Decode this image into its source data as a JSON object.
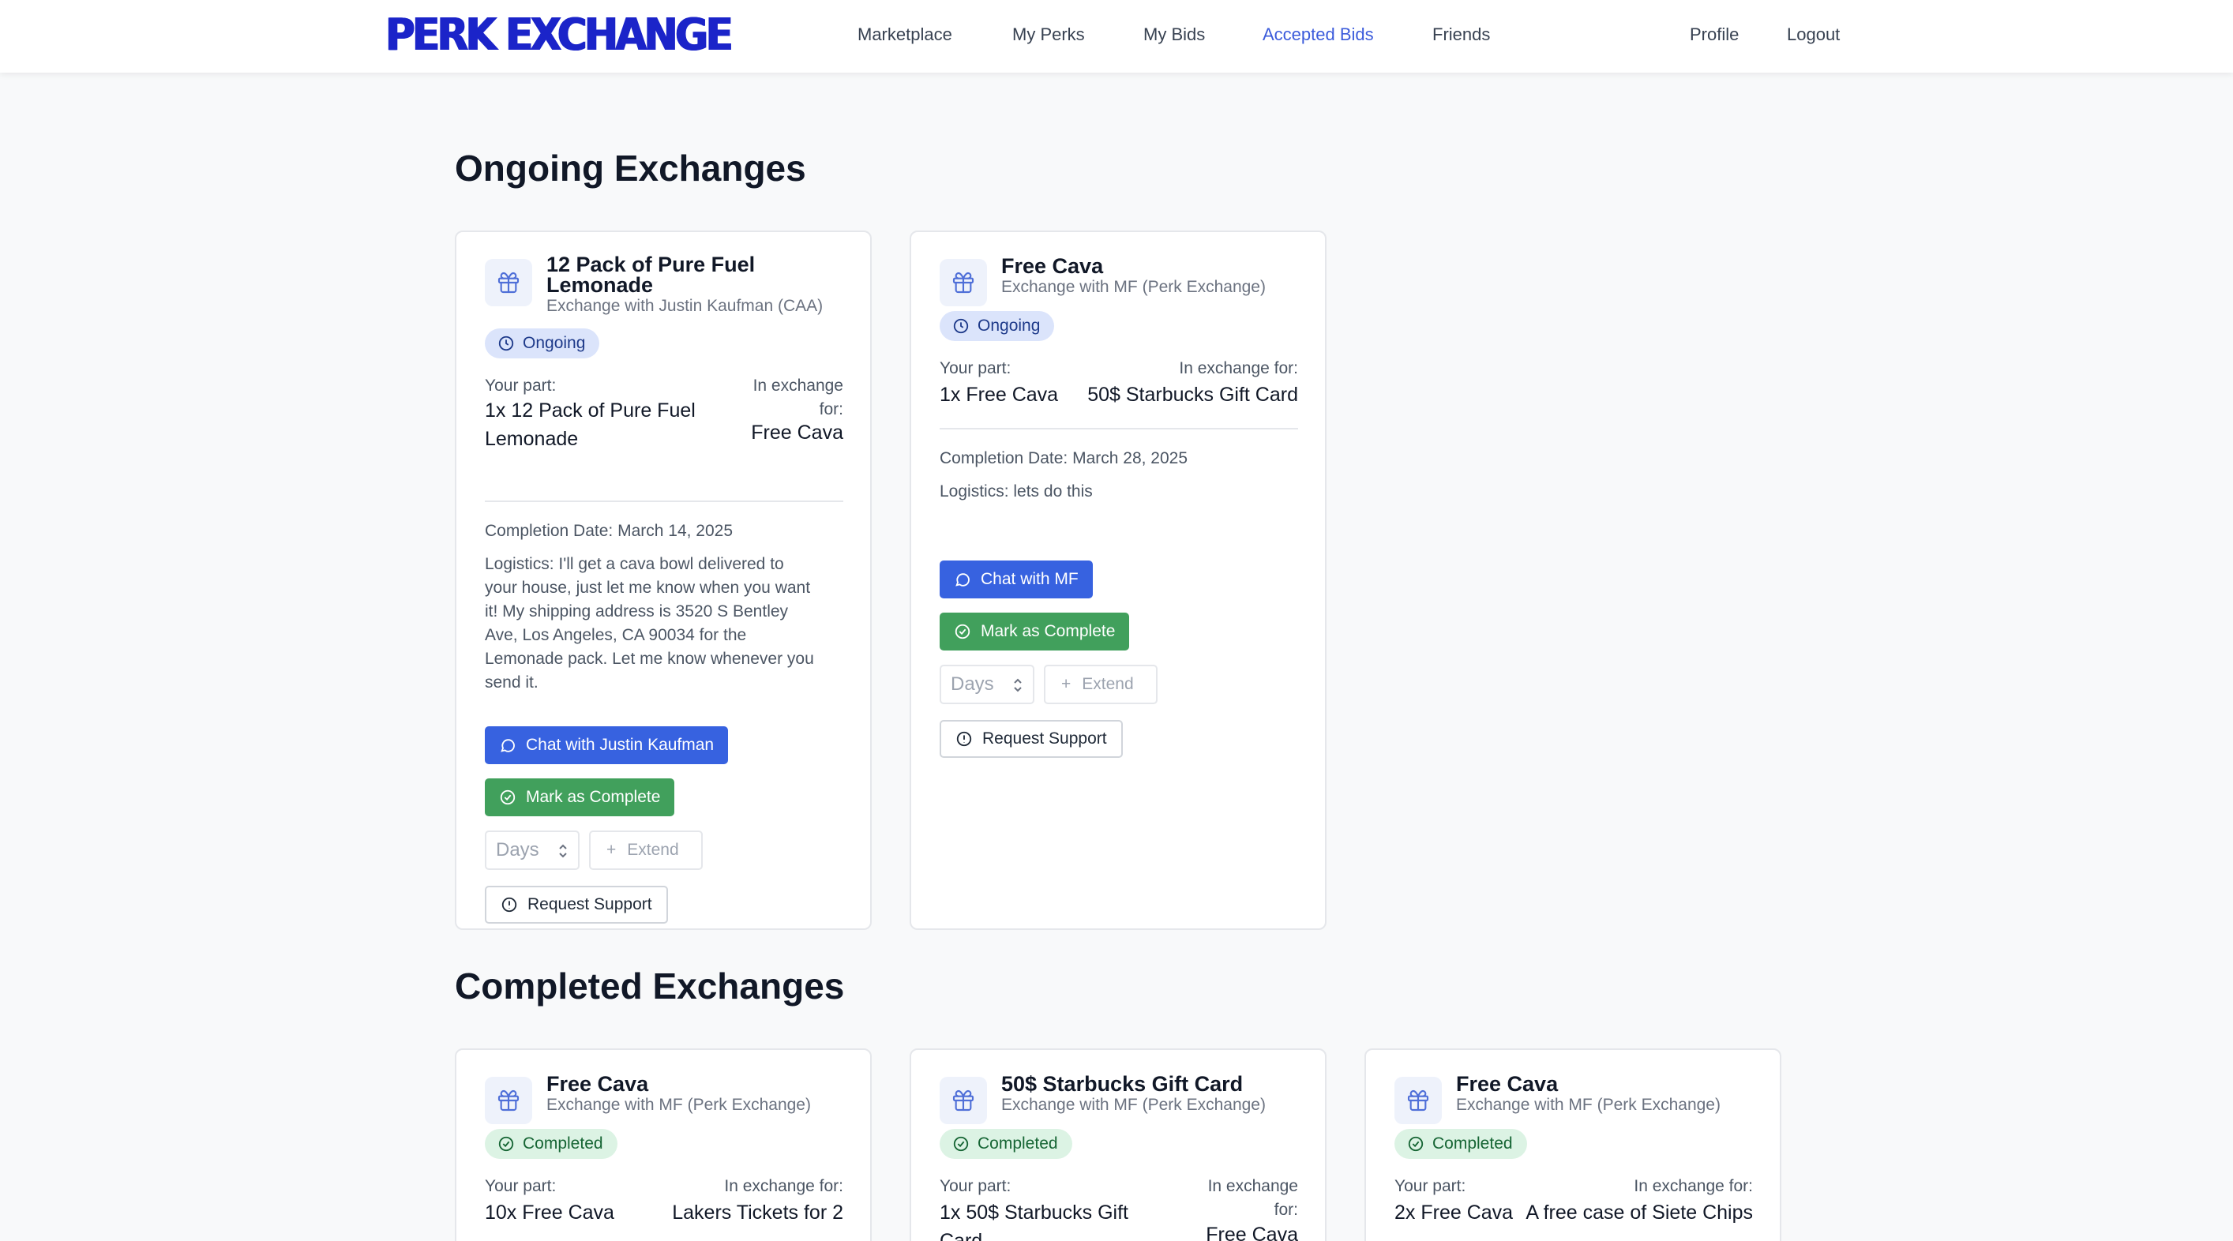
{
  "header": {
    "logo": "PERK EXCHANGE",
    "nav": [
      "Marketplace",
      "My Perks",
      "My Bids",
      "Accepted Bids",
      "Friends"
    ],
    "active": "Accepted Bids",
    "profile": "Profile",
    "logout": "Logout"
  },
  "colors": {
    "brand": "#1b24c9",
    "accent": "#3b5bdb",
    "chat_button": "#3762e0",
    "complete_button": "#41a05c",
    "ongoing_badge": "#dbe4fb",
    "completed_badge": "#dcf3e4"
  },
  "labels": {
    "your_part": "Your part:",
    "in_exchange_for": "In exchange for:",
    "in_exchange_line1": "In exchange",
    "in_exchange_line2": "for:",
    "mark_complete": "Mark as Complete",
    "days_placeholder": "Days",
    "extend": "Extend",
    "request_support": "Request Support"
  },
  "ongoing": {
    "title": "Ongoing Exchanges",
    "cards": [
      {
        "title_line1": "12 Pack of Pure Fuel",
        "title_line2": "Lemonade",
        "subtitle": "Exchange with Justin Kaufman (CAA)",
        "status": "Ongoing",
        "your_part_line1": "1x 12 Pack of Pure Fuel",
        "your_part_line2": "Lemonade",
        "in_exchange": "Free Cava",
        "completion": "Completion Date: March 14, 2025",
        "logistics": [
          "Logistics: I'll get a cava bowl delivered to",
          "your house, just let me know when you want",
          "it! My shipping address is 3520 S Bentley",
          "Ave, Los Angeles, CA 90034 for the",
          "Lemonade pack. Let me know whenever you",
          "send it."
        ],
        "chat": "Chat with Justin Kaufman"
      },
      {
        "title": "Free Cava",
        "subtitle": "Exchange with MF (Perk Exchange)",
        "status": "Ongoing",
        "your_part": "1x Free Cava",
        "in_exchange": "50$ Starbucks Gift Card",
        "completion": "Completion Date: March 28, 2025",
        "logistics": "Logistics: lets do this",
        "chat": "Chat with MF"
      }
    ]
  },
  "completed": {
    "title": "Completed Exchanges",
    "cards": [
      {
        "title": "Free Cava",
        "subtitle": "Exchange with MF (Perk Exchange)",
        "status": "Completed",
        "your_part": "10x Free Cava",
        "in_exchange": "Lakers Tickets for 2"
      },
      {
        "title": "50$ Starbucks Gift Card",
        "subtitle": "Exchange with MF (Perk Exchange)",
        "status": "Completed",
        "your_part_line1": "1x 50$ Starbucks Gift",
        "your_part_line2": "Card",
        "in_exchange": "Free Cava"
      },
      {
        "title": "Free Cava",
        "subtitle": "Exchange with MF (Perk Exchange)",
        "status": "Completed",
        "your_part": "2x Free Cava",
        "in_exchange": "A free case of Siete Chips"
      }
    ]
  }
}
